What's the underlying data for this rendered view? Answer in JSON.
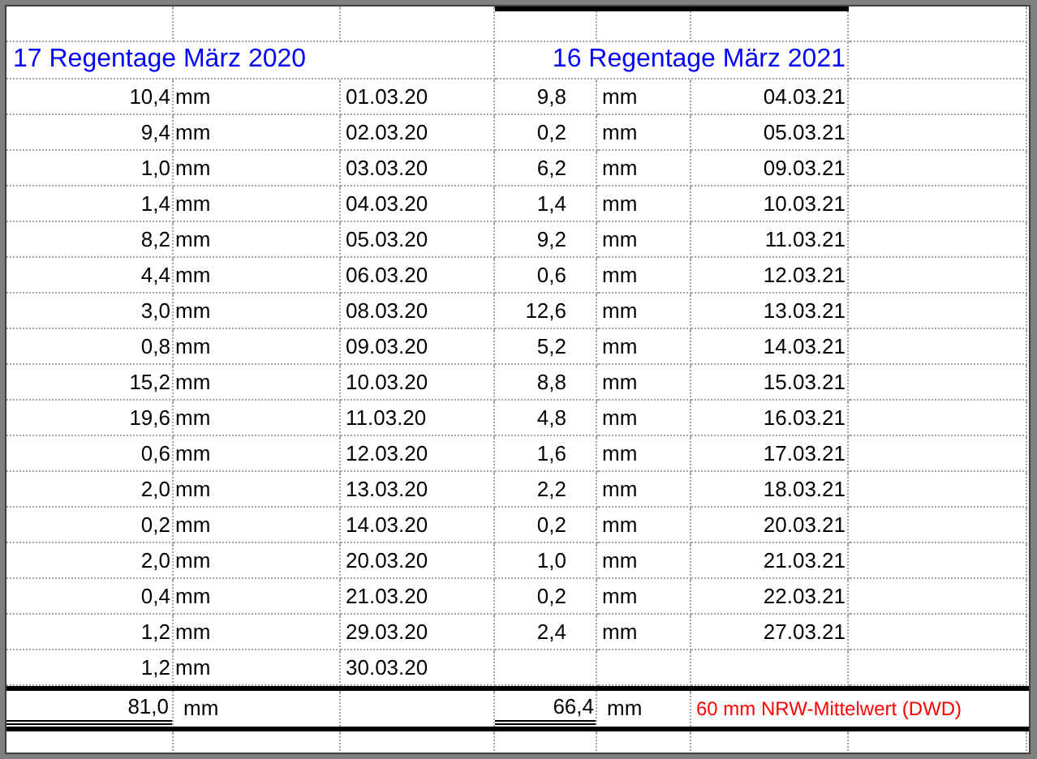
{
  "left": {
    "heading": "17 Regentage März 2020",
    "rows": [
      {
        "amount": "10,4",
        "unit": "mm",
        "date": "01.03.20"
      },
      {
        "amount": "9,4",
        "unit": "mm",
        "date": "02.03.20"
      },
      {
        "amount": "1,0",
        "unit": "mm",
        "date": "03.03.20"
      },
      {
        "amount": "1,4",
        "unit": "mm",
        "date": "04.03.20"
      },
      {
        "amount": "8,2",
        "unit": "mm",
        "date": "05.03.20"
      },
      {
        "amount": "4,4",
        "unit": "mm",
        "date": "06.03.20"
      },
      {
        "amount": "3,0",
        "unit": "mm",
        "date": "08.03.20"
      },
      {
        "amount": "0,8",
        "unit": "mm",
        "date": "09.03.20"
      },
      {
        "amount": "15,2",
        "unit": "mm",
        "date": "10.03.20"
      },
      {
        "amount": "19,6",
        "unit": "mm",
        "date": "11.03.20"
      },
      {
        "amount": "0,6",
        "unit": "mm",
        "date": "12.03.20"
      },
      {
        "amount": "2,0",
        "unit": "mm",
        "date": "13.03.20"
      },
      {
        "amount": "0,2",
        "unit": "mm",
        "date": "14.03.20"
      },
      {
        "amount": "2,0",
        "unit": "mm",
        "date": "20.03.20"
      },
      {
        "amount": "0,4",
        "unit": "mm",
        "date": "21.03.20"
      },
      {
        "amount": "1,2",
        "unit": "mm",
        "date": "29.03.20"
      },
      {
        "amount": "1,2",
        "unit": "mm",
        "date": "30.03.20"
      }
    ],
    "total": {
      "amount": "81,0",
      "unit": "mm"
    }
  },
  "right": {
    "heading": "16 Regentage März 2021",
    "rows": [
      {
        "amount": "9,8",
        "unit": "mm",
        "date": "04.03.21"
      },
      {
        "amount": "0,2",
        "unit": "mm",
        "date": "05.03.21"
      },
      {
        "amount": "6,2",
        "unit": "mm",
        "date": "09.03.21"
      },
      {
        "amount": "1,4",
        "unit": "mm",
        "date": "10.03.21"
      },
      {
        "amount": "9,2",
        "unit": "mm",
        "date": "11.03.21"
      },
      {
        "amount": "0,6",
        "unit": "mm",
        "date": "12.03.21"
      },
      {
        "amount": "12,6",
        "unit": "mm",
        "date": "13.03.21"
      },
      {
        "amount": "5,2",
        "unit": "mm",
        "date": "14.03.21"
      },
      {
        "amount": "8,8",
        "unit": "mm",
        "date": "15.03.21"
      },
      {
        "amount": "4,8",
        "unit": "mm",
        "date": "16.03.21"
      },
      {
        "amount": "1,6",
        "unit": "mm",
        "date": "17.03.21"
      },
      {
        "amount": "2,2",
        "unit": "mm",
        "date": "18.03.21"
      },
      {
        "amount": "0,2",
        "unit": "mm",
        "date": "20.03.21"
      },
      {
        "amount": "1,0",
        "unit": "mm",
        "date": "21.03.21"
      },
      {
        "amount": "0,2",
        "unit": "mm",
        "date": "22.03.21"
      },
      {
        "amount": "2,4",
        "unit": "mm",
        "date": "27.03.21"
      }
    ],
    "total": {
      "amount": "66,4",
      "unit": "mm"
    }
  },
  "note": "60 mm NRW-Mittelwert (DWD)"
}
